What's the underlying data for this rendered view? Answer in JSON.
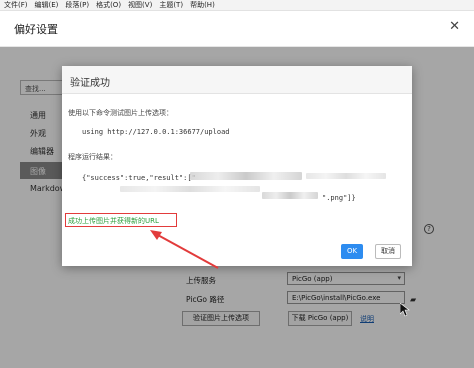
{
  "menubar": [
    "文件(F)",
    "编辑(E)",
    "段落(P)",
    "格式(O)",
    "视图(V)",
    "主题(T)",
    "帮助(H)"
  ],
  "window": {
    "title": "偏好设置",
    "close": "✕"
  },
  "sidebar": {
    "search_placeholder": "查找...",
    "items": [
      "通用",
      "外观",
      "编辑器",
      "图像",
      "Markdown"
    ]
  },
  "settings": {
    "upload_service_label": "上传服务",
    "upload_service_value": "PicGo (app)",
    "picgo_path_label": "PicGo 路径",
    "picgo_path_value": "E:\\PicGo\\install\\PicGo.exe",
    "verify_button": "验证图片上传选项",
    "download_button": "下载 PicGo (app)",
    "help_link": "说明"
  },
  "dialog": {
    "title": "验证成功",
    "desc": "使用以下命令测试图片上传选项：",
    "command": "using http://127.0.0.1:36677/upload",
    "result_label": "程序运行结果：",
    "result_text": "{\"success\":true,\"result\":[\"",
    "result_tail": "\".png\"]}",
    "success_msg": "成功上传图片并获得新的URL",
    "ok_label": "OK",
    "cancel_label": "取消"
  },
  "colors": {
    "accent": "#2d8cf0",
    "success_text": "#2a9d3a",
    "annotation": "#e23b3b"
  }
}
